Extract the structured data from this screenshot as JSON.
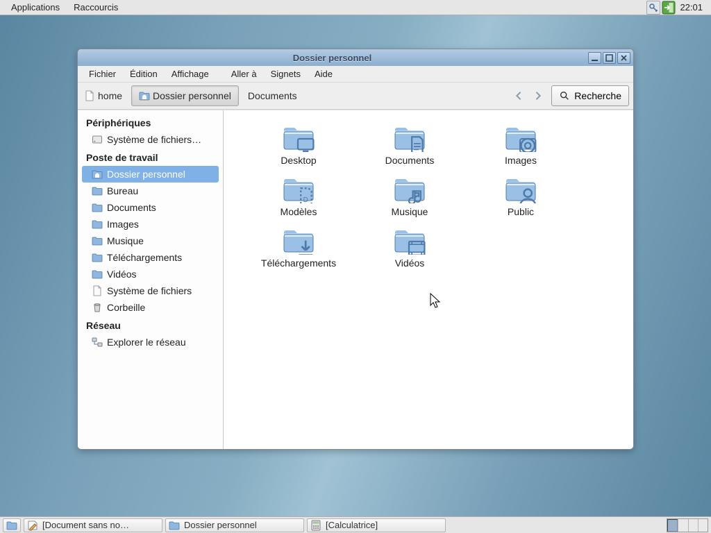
{
  "panel": {
    "top_menus": [
      "Applications",
      "Raccourcis"
    ],
    "clock": "22:01"
  },
  "window": {
    "title": "Dossier personnel",
    "menus": [
      "Fichier",
      "Édition",
      "Affichage",
      "Aller à",
      "Signets",
      "Aide"
    ],
    "path": [
      "home",
      "Dossier personnel",
      "Documents"
    ],
    "path_active_index": 1,
    "search_label": "Recherche"
  },
  "sidebar": {
    "groups": [
      {
        "title": "Périphériques",
        "items": [
          {
            "icon": "disk",
            "label": "Système de fichiers…"
          }
        ]
      },
      {
        "title": "Poste de travail",
        "items": [
          {
            "icon": "home",
            "label": "Dossier personnel",
            "active": true
          },
          {
            "icon": "folder",
            "label": "Bureau"
          },
          {
            "icon": "folder",
            "label": "Documents"
          },
          {
            "icon": "folder",
            "label": "Images"
          },
          {
            "icon": "folder",
            "label": "Musique"
          },
          {
            "icon": "folder",
            "label": "Téléchargements"
          },
          {
            "icon": "folder",
            "label": "Vidéos"
          },
          {
            "icon": "file",
            "label": "Système de fichiers"
          },
          {
            "icon": "trash",
            "label": "Corbeille"
          }
        ]
      },
      {
        "title": "Réseau",
        "items": [
          {
            "icon": "network",
            "label": "Explorer le réseau"
          }
        ]
      }
    ]
  },
  "folders": [
    {
      "icon": "desktop",
      "label": "Desktop"
    },
    {
      "icon": "docs",
      "label": "Documents"
    },
    {
      "icon": "images",
      "label": "Images"
    },
    {
      "icon": "template",
      "label": "Modèles"
    },
    {
      "icon": "music",
      "label": "Musique"
    },
    {
      "icon": "public",
      "label": "Public"
    },
    {
      "icon": "download",
      "label": "Téléchargements"
    },
    {
      "icon": "video",
      "label": "Vidéos"
    }
  ],
  "taskbar": {
    "items": [
      {
        "icon": "text",
        "label": "[Document sans no…"
      },
      {
        "icon": "folder",
        "label": "Dossier personnel"
      },
      {
        "icon": "calc",
        "label": "[Calculatrice]"
      }
    ]
  }
}
